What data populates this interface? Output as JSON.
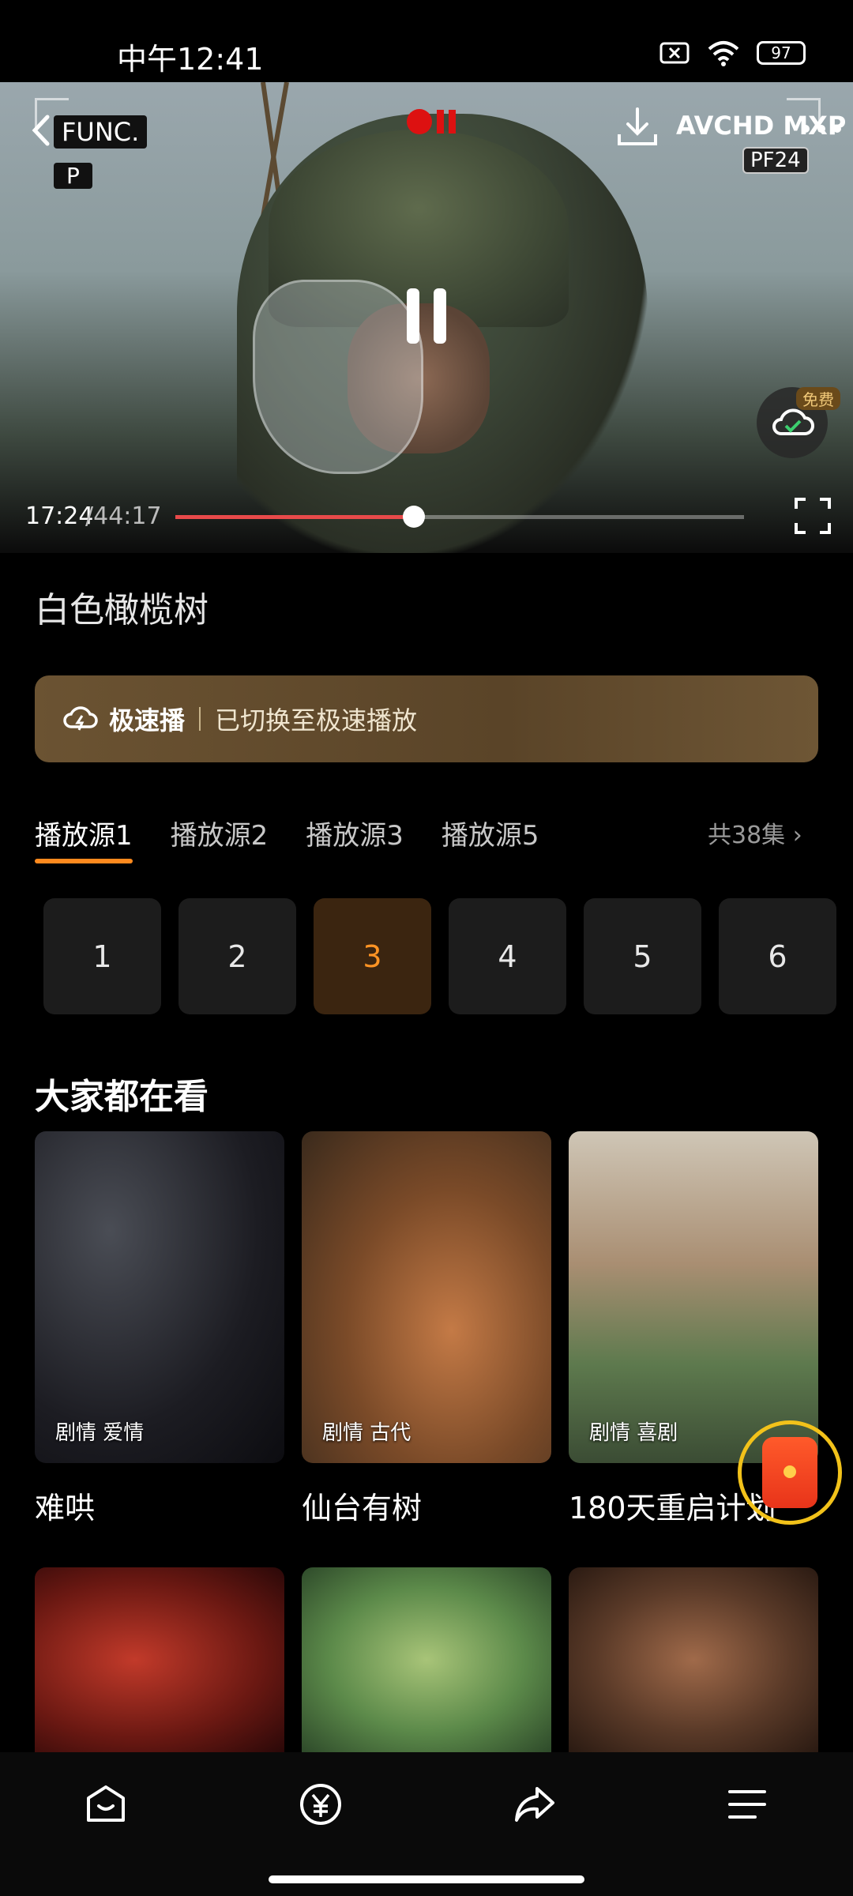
{
  "status_bar": {
    "time": "中午12:41",
    "battery": "97"
  },
  "player": {
    "hud": {
      "func": "FUNC.",
      "mode": "P",
      "right_label": "AVCHD MXP",
      "frame": "PF24"
    },
    "free_badge": "免费",
    "time_current": "17:24",
    "time_total": "/44:17",
    "progress": 0.42
  },
  "title": "白色橄榄树",
  "speed_banner": {
    "label": "极速播",
    "message": "已切换至极速播放"
  },
  "sources": {
    "tabs": [
      "播放源1",
      "播放源2",
      "播放源3",
      "播放源5"
    ],
    "active": 0,
    "total": "共38集"
  },
  "episodes": {
    "items": [
      "1",
      "2",
      "3",
      "4",
      "5",
      "6"
    ],
    "active": 2
  },
  "recommend": {
    "heading": "大家都在看",
    "cards": [
      {
        "title": "难哄",
        "tags": "剧情 爱情"
      },
      {
        "title": "仙台有树",
        "tags": "剧情 古代"
      },
      {
        "title": "180天重启计划",
        "tags": "剧情 喜剧"
      }
    ]
  },
  "icons": [
    "back-icon",
    "download-icon",
    "more-icon",
    "pause-icon",
    "cloud-icon",
    "fullscreen-icon",
    "home-icon",
    "yuan-icon",
    "share-icon",
    "menu-icon",
    "red-packet-icon"
  ],
  "colors": {
    "accent": "#ff8a1e",
    "progress": "#e84a4a",
    "banner": "#6b5332"
  }
}
